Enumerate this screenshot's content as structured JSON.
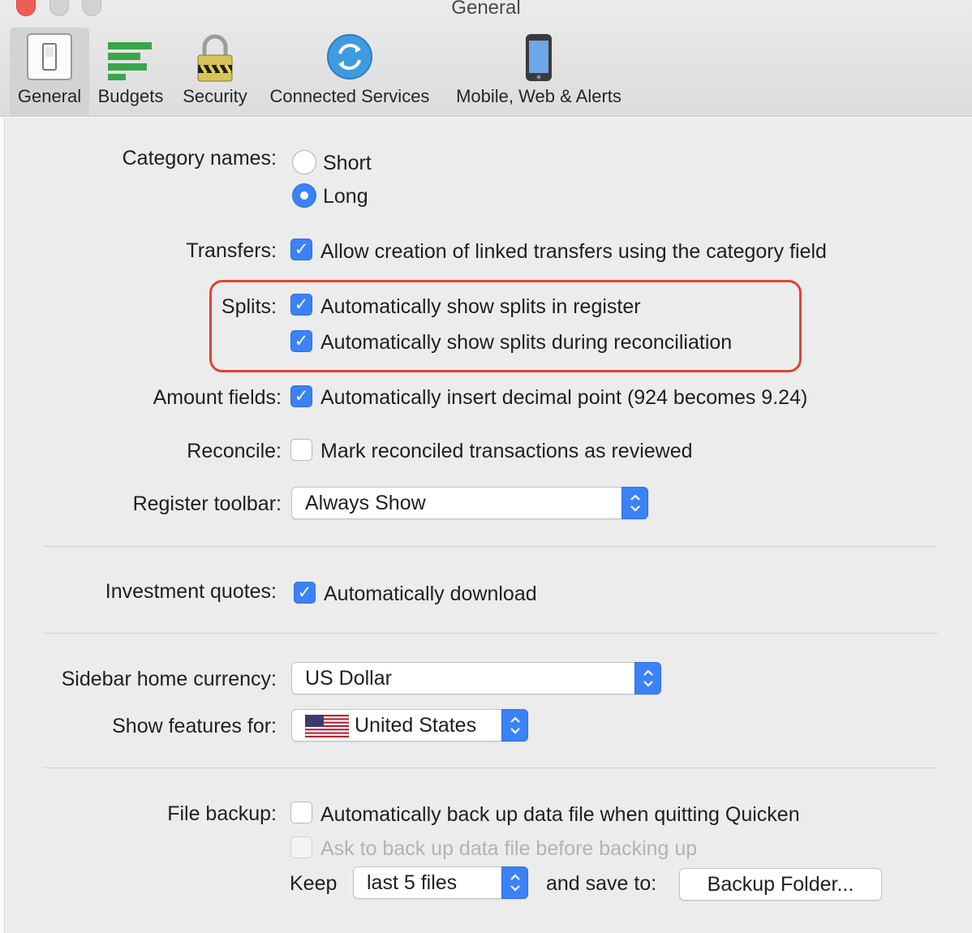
{
  "window": {
    "title": "General"
  },
  "tabs": [
    {
      "label": "General",
      "icon": "switch-icon",
      "active": true
    },
    {
      "label": "Budgets",
      "icon": "budget-bars-icon"
    },
    {
      "label": "Security",
      "icon": "padlock-icon"
    },
    {
      "label": "Connected Services",
      "icon": "sync-icon"
    },
    {
      "label": "Mobile, Web & Alerts",
      "icon": "phone-icon"
    }
  ],
  "settings": {
    "category_names": {
      "label": "Category names:",
      "options": [
        "Short",
        "Long"
      ],
      "selected": "Long"
    },
    "transfers": {
      "label": "Transfers:",
      "text": "Allow creation of linked transfers using the category field",
      "checked": true
    },
    "splits": {
      "label": "Splits:",
      "options": [
        {
          "text": "Automatically show splits in register",
          "checked": true
        },
        {
          "text": "Automatically show splits during reconciliation",
          "checked": true
        }
      ]
    },
    "amount_fields": {
      "label": "Amount fields:",
      "text": "Automatically insert decimal point (924 becomes 9.24)",
      "checked": true
    },
    "reconcile": {
      "label": "Reconcile:",
      "text": "Mark reconciled transactions as reviewed",
      "checked": false
    },
    "register_toolbar": {
      "label": "Register toolbar:",
      "value": "Always Show"
    },
    "investment_quotes": {
      "label": "Investment quotes:",
      "text": "Automatically download",
      "checked": true
    },
    "sidebar_home_currency": {
      "label": "Sidebar home currency:",
      "value": "US Dollar"
    },
    "show_features_for": {
      "label": "Show features for:",
      "value": "United States",
      "icon": "us-flag-icon"
    },
    "file_backup": {
      "label": "File backup:",
      "auto_backup": {
        "text": "Automatically back up data file when quitting Quicken",
        "checked": false
      },
      "ask_backup": {
        "text": "Ask to back up data file before backing up",
        "checked": false,
        "disabled": true
      },
      "keep_label": "Keep",
      "keep_value": "last 5 files",
      "save_to_label": "and save to:",
      "backup_folder_button": "Backup Folder..."
    }
  },
  "colors": {
    "accent": "#3b82f6",
    "highlight": "#e0432f"
  }
}
